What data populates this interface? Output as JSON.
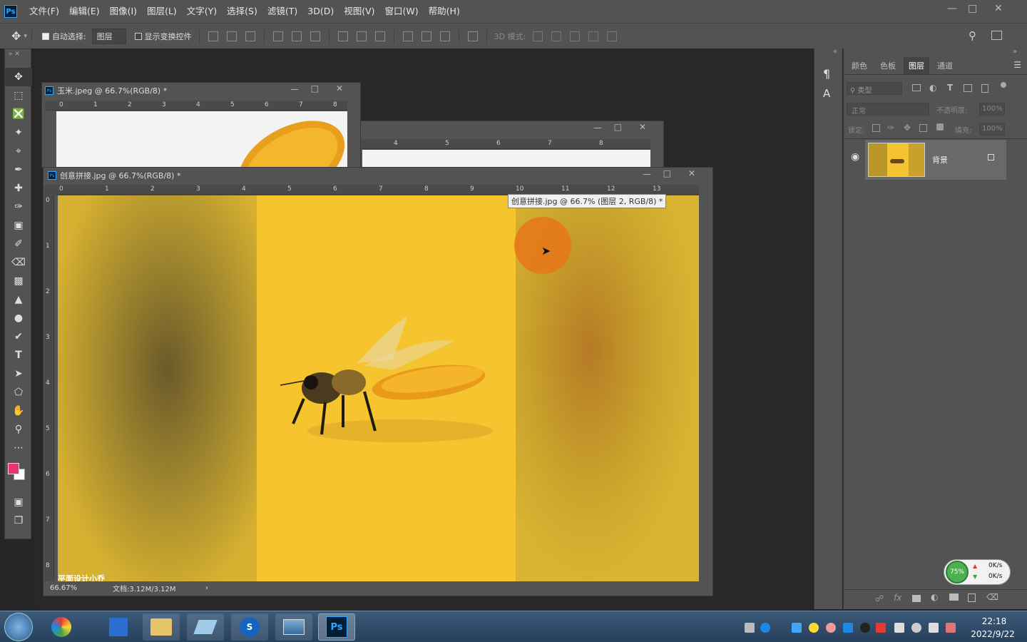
{
  "app": {
    "logo": "Ps"
  },
  "menu": [
    "文件(F)",
    "编辑(E)",
    "图像(I)",
    "图层(L)",
    "文字(Y)",
    "选择(S)",
    "滤镜(T)",
    "3D(D)",
    "视图(V)",
    "窗口(W)",
    "帮助(H)"
  ],
  "options": {
    "auto_select_label": "自动选择:",
    "auto_select_value": "图层",
    "show_transform_label": "显示变换控件",
    "mode3d_label": "3D 模式:"
  },
  "docs": {
    "corn": {
      "title": "玉米.jpeg @ 66.7%(RGB/8) *"
    },
    "main": {
      "title": "创意拼接.jpg @ 66.7%(RGB/8) *"
    },
    "tooltip": "创意拼接.jpg @ 66.7% (图层 2, RGB/8) *",
    "watermark": "平面设计小乔"
  },
  "ruler": {
    "h": [
      "0",
      "1",
      "2",
      "3",
      "4",
      "5",
      "6",
      "7",
      "8",
      "9",
      "10",
      "11",
      "12",
      "13"
    ],
    "v": [
      "0",
      "1",
      "2",
      "3",
      "4",
      "5",
      "6",
      "7",
      "8"
    ],
    "corn_h": [
      "0",
      "1",
      "2",
      "3",
      "4",
      "5",
      "6",
      "7",
      "8"
    ],
    "second_h": [
      "4",
      "5",
      "6",
      "7",
      "8"
    ]
  },
  "status": {
    "zoom": "66.67%",
    "doc": "文档:3.12M/3.12M"
  },
  "panel": {
    "tabs": [
      "颜色",
      "色板",
      "图层",
      "通道"
    ],
    "active_tab": "图层",
    "filter_placeholder": "类型",
    "blend_mode": "正常",
    "opacity_label": "不透明度:",
    "opacity_value": "100%",
    "lock_label": "锁定:",
    "fill_label": "填充:",
    "fill_value": "100%",
    "layer_name": "背景"
  },
  "netmeter": {
    "percent": "75%",
    "up": "0K/s",
    "down": "0K/s"
  },
  "clock": {
    "time": "22:18",
    "date": "2022/9/22"
  },
  "colors": {
    "foreground": "#e8336d",
    "background": "#ffffff",
    "canvas": "#f4c430",
    "accent": "#31a8ff"
  }
}
